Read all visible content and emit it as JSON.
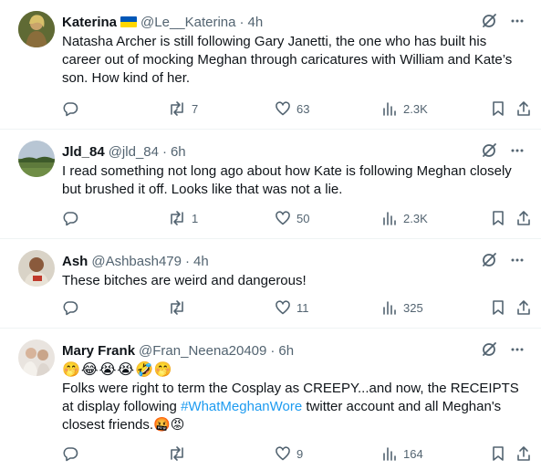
{
  "tweets": [
    {
      "name": "Katerina",
      "handle": "@Le__Katerina",
      "time": "4h",
      "body": "Natasha Archer is still following Gary Janetti, the one who has built his career out of mocking Meghan through caricatures with William and Kate’s son. How kind of her.",
      "retweets": "7",
      "likes": "63",
      "views": "2.3K"
    },
    {
      "name": "Jld_84",
      "handle": "@jld_84",
      "time": "6h",
      "body": "I read something not long ago about how Kate is following Meghan closely but brushed it off. Looks like that was not a lie.",
      "retweets": "1",
      "likes": "50",
      "views": "2.3K"
    },
    {
      "name": "Ash",
      "handle": "@Ashbash479",
      "time": "4h",
      "body": "These bitches are weird and dangerous!",
      "retweets": "",
      "likes": "11",
      "views": "325"
    },
    {
      "name": "Mary Frank",
      "handle": "@Fran_Neena20409",
      "time": "6h",
      "emojis": "🤭😂😭😭🤣🤭",
      "body_pre": "Folks were right to term the Cosplay as CREEPY...and now, the RECEIPTS at display following ",
      "hashtag": "#WhatMeghanWore",
      "body_post": " twitter account and all Meghan's closest friends.🤬😡",
      "retweets": "",
      "likes": "9",
      "views": "164"
    }
  ],
  "dot": "·",
  "icons": [
    "grok-icon",
    "more-icon",
    "reply-icon",
    "retweet-icon",
    "like-icon",
    "views-icon",
    "bookmark-icon",
    "share-icon"
  ],
  "colors": {
    "text": "#0f1419",
    "muted": "#536471",
    "link": "#1d9bf0",
    "divider": "#eff3f4"
  }
}
